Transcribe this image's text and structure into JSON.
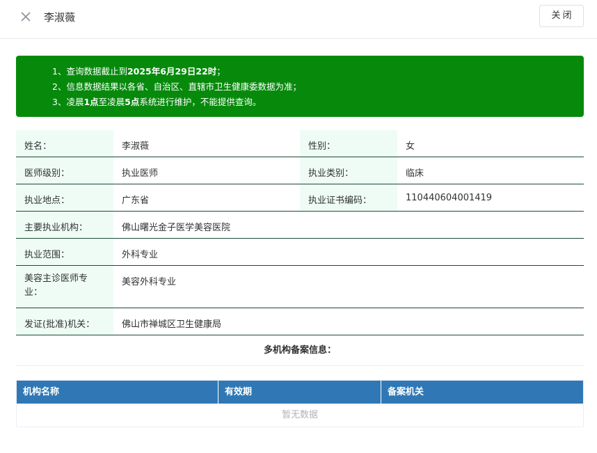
{
  "header": {
    "title": "李淑薇",
    "close_label": "关闭",
    "close_icon": "close-icon"
  },
  "notice": {
    "line1_prefix": "1、查询数据截止到",
    "line1_bold": "2025年6月29日22时",
    "line1_suffix": "；",
    "line2": "2、信息数据结果以各省、自治区、直辖市卫生健康委数据为准；",
    "line3_prefix": "3、凌晨",
    "line3_bold1": "1点",
    "line3_mid": "至凌晨",
    "line3_bold2": "5点",
    "line3_suffix": "系统进行维护，不能提供查询。",
    "background": "#078a0c"
  },
  "info": {
    "name_label": "姓名：",
    "name_value": "李淑薇",
    "gender_label": "性别：",
    "gender_value": "女",
    "level_label": "医师级别：",
    "level_value": "执业医师",
    "category_label": "执业类别：",
    "category_value": "临床",
    "location_label": "执业地点：",
    "location_value": "广东省",
    "cert_label": "执业证书编码：",
    "cert_value": "110440604001419",
    "org_label": "主要执业机构：",
    "org_value": "佛山曙光金子医学美容医院",
    "scope_label": "执业范围：",
    "scope_value": "外科专业",
    "cosmetic_label": "美容主诊医师专业：",
    "cosmetic_value": "美容外科专业",
    "issuer_label": "发证(批准)机关：",
    "issuer_value": "佛山市禅城区卫生健康局"
  },
  "multi": {
    "title": "多机构备案信息："
  },
  "table": {
    "columns": [
      "机构名称",
      "有效期",
      "备案机关"
    ],
    "empty_text": "暂无数据",
    "header_color": "#3078b5"
  }
}
